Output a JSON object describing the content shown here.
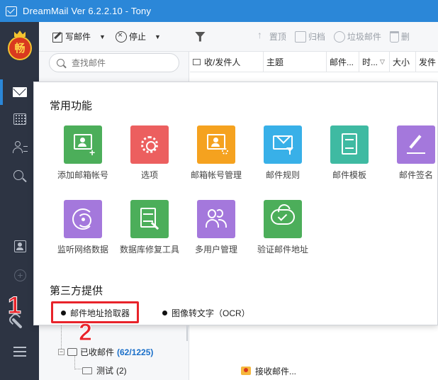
{
  "window": {
    "title": "DreamMail Ver 6.2.2.10  -  Tony"
  },
  "rail": {
    "logo_char": "畅",
    "items": [
      "mail",
      "calendar",
      "contacts",
      "search",
      "contact-card",
      "add",
      "tools",
      "menu"
    ]
  },
  "toolbar": {
    "compose_label": "写邮件",
    "stop_label": "停止",
    "pin_label": "置顶",
    "archive_label": "归档",
    "spam_label": "垃圾邮件",
    "delete_label": "删"
  },
  "search": {
    "placeholder": "查找邮件"
  },
  "columns": [
    {
      "label": "收/发件人"
    },
    {
      "label": "主题"
    },
    {
      "label": "邮件..."
    },
    {
      "label": "时..."
    },
    {
      "label": "大小"
    },
    {
      "label": "发件"
    }
  ],
  "popup": {
    "common_title": "常用功能",
    "tiles": [
      {
        "label": "添加邮箱帐号",
        "color": "#4cae5a"
      },
      {
        "label": "选项",
        "color": "#ec5f5f"
      },
      {
        "label": "邮箱帐号管理",
        "color": "#f5a21f"
      },
      {
        "label": "邮件规则",
        "color": "#38b0e8"
      },
      {
        "label": "邮件模板",
        "color": "#3fbaa2"
      },
      {
        "label": "邮件签名",
        "color": "#a478dc"
      },
      {
        "label": "监听网络数据",
        "color": "#a478dc"
      },
      {
        "label": "数据库修复工具",
        "color": "#4cae5a"
      },
      {
        "label": "多用户管理",
        "color": "#a478dc"
      },
      {
        "label": "验证邮件地址",
        "color": "#4cae5a"
      }
    ],
    "third_party_title": "第三方提供",
    "third_party": [
      {
        "label": "邮件地址拾取器"
      },
      {
        "label": "图像转文字（OCR）"
      }
    ]
  },
  "annotations": {
    "one": "1",
    "two": "2"
  },
  "tree": {
    "inbox_label": "已收邮件",
    "inbox_count": "(62/1225)",
    "sub_label": "测试",
    "sub_count": "(2)"
  },
  "status": {
    "text": "接收邮件..."
  }
}
